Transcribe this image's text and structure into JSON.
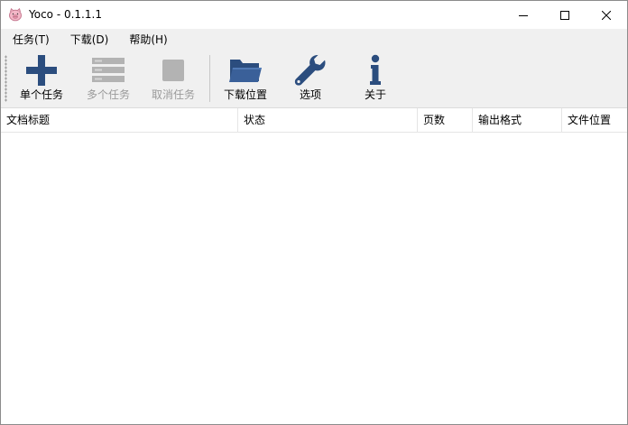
{
  "window": {
    "title": "Yoco - 0.1.1.1",
    "icon": "app-pig-icon",
    "controls": [
      "minimize-icon",
      "maximize-icon",
      "close-icon"
    ]
  },
  "menu": [
    {
      "label": "任务(T)"
    },
    {
      "label": "下载(D)"
    },
    {
      "label": "帮助(H)"
    }
  ],
  "toolbar": {
    "buttons": [
      {
        "label": "单个任务",
        "icon": "plus-icon",
        "enabled": true
      },
      {
        "label": "多个任务",
        "icon": "list-icon",
        "enabled": false
      },
      {
        "label": "取消任务",
        "icon": "stop-icon",
        "enabled": false
      },
      {
        "label": "下载位置",
        "icon": "folder-icon",
        "enabled": true
      },
      {
        "label": "选项",
        "icon": "wrench-icon",
        "enabled": true
      },
      {
        "label": "关于",
        "icon": "info-icon",
        "enabled": true
      }
    ]
  },
  "table": {
    "columns": [
      "文档标题",
      "状态",
      "页数",
      "输出格式",
      "文件位置"
    ],
    "rows": []
  },
  "colors": {
    "accent_icon": "#2b4d7e",
    "disabled_icon": "#b3b3b3",
    "chrome_bg": "#f0f0f0"
  }
}
